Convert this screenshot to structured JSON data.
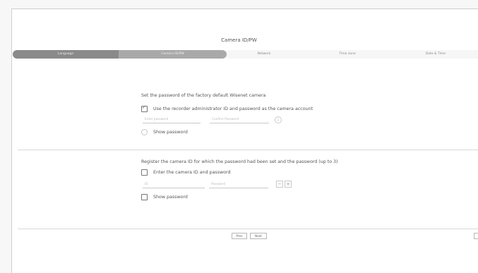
{
  "window": {
    "title": "Camera ID/PW"
  },
  "steps": [
    {
      "label": "Language",
      "state": "done"
    },
    {
      "label": "Camera ID/PW",
      "state": "current"
    },
    {
      "label": "Network",
      "state": "pending"
    },
    {
      "label": "Time zone",
      "state": "pending"
    },
    {
      "label": "Date & Time",
      "state": "pending"
    }
  ],
  "factory_section": {
    "heading": "Set the password of the factory default Wisenet camera",
    "use_recorder_label": "Use the recorder administrator ID and password as the camera account",
    "use_recorder_checked": true,
    "password_placeholder": "Enter password",
    "confirm_placeholder": "Confirm Password",
    "show_password_label": "Show password"
  },
  "register_section": {
    "heading": "Register the camera ID for which the password had been set and the password (up to 3)",
    "enter_id_label": "Enter the camera ID and password",
    "enter_id_checked": false,
    "id_placeholder": "ID",
    "password_placeholder": "Password",
    "remove_label": "−",
    "add_label": "+",
    "show_password_label": "Show password"
  },
  "footer": {
    "prev_label": "Prev",
    "next_label": "Next"
  }
}
